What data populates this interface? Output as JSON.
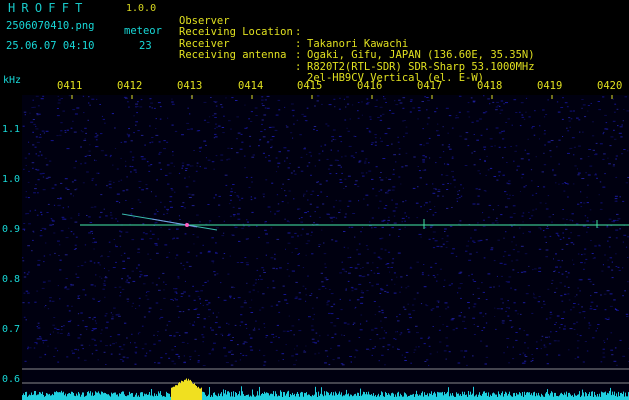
{
  "app": {
    "title": "HROFFT",
    "version": "1.0.0",
    "filename": "2506070410.png",
    "datetime": "25.06.07 04:10",
    "meteor_label": "meteor",
    "meteor_count": "23"
  },
  "info": [
    {
      "label": "Observer",
      "value": "Takanori Kawachi"
    },
    {
      "label": "Receiving Location",
      "value": "Ogaki, Gifu, JAPAN (136.60E, 35.35N)"
    },
    {
      "label": "Receiver",
      "value": "R820T2(RTL-SDR) SDR-Sharp 53.1000MHz"
    },
    {
      "label": "Receiving antenna",
      "value": "2el-HB9CV Vertical (el. E-W)"
    }
  ],
  "info_separator": ":",
  "axis": {
    "y_unit": "kHz",
    "time_ticks": [
      "0411",
      "0412",
      "0413",
      "0414",
      "0415",
      "0416",
      "0417",
      "0418",
      "0419",
      "0420"
    ],
    "freq_ticks": [
      "1.1",
      "1.0",
      "0.9",
      "0.8",
      "0.7",
      "0.6"
    ]
  },
  "colors": {
    "cyan": "#18d8d8",
    "yellow": "#e0e020",
    "noise": "#101070",
    "carrier": "#40e0a0",
    "echo": "#ff60c0"
  }
}
